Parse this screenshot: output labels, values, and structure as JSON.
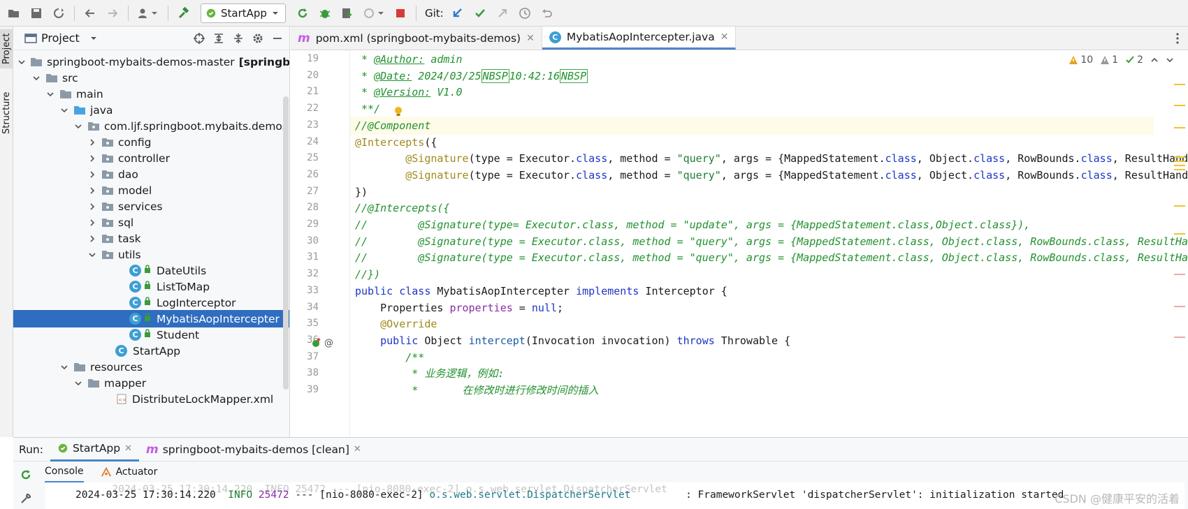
{
  "toolbar": {
    "run_config": "StartApp",
    "git_label": "Git:"
  },
  "left_stripe": {
    "project_tab": "Project",
    "structure_tab": "Structure"
  },
  "project": {
    "title": "Project",
    "tree": [
      {
        "label": "springboot-mybaits-demos-master",
        "bold_suffix": "[springboot",
        "indent": 0,
        "arrow": "down",
        "icon": "module-folder"
      },
      {
        "label": "src",
        "indent": 1,
        "arrow": "down",
        "icon": "folder"
      },
      {
        "label": "main",
        "indent": 2,
        "arrow": "down",
        "icon": "folder"
      },
      {
        "label": "java",
        "indent": 3,
        "arrow": "down",
        "icon": "source-folder"
      },
      {
        "label": "com.ljf.springboot.mybaits.demos",
        "indent": 4,
        "arrow": "down",
        "icon": "package"
      },
      {
        "label": "config",
        "indent": 5,
        "arrow": "right",
        "icon": "package"
      },
      {
        "label": "controller",
        "indent": 5,
        "arrow": "right",
        "icon": "package"
      },
      {
        "label": "dao",
        "indent": 5,
        "arrow": "right",
        "icon": "package"
      },
      {
        "label": "model",
        "indent": 5,
        "arrow": "right",
        "icon": "package"
      },
      {
        "label": "services",
        "indent": 5,
        "arrow": "right",
        "icon": "package"
      },
      {
        "label": "sql",
        "indent": 5,
        "arrow": "right",
        "icon": "package"
      },
      {
        "label": "task",
        "indent": 5,
        "arrow": "right",
        "icon": "package"
      },
      {
        "label": "utils",
        "indent": 5,
        "arrow": "down",
        "icon": "package"
      },
      {
        "label": "DateUtils",
        "indent": 7,
        "arrow": "none",
        "icon": "class"
      },
      {
        "label": "ListToMap",
        "indent": 7,
        "arrow": "none",
        "icon": "class"
      },
      {
        "label": "LogInterceptor",
        "indent": 7,
        "arrow": "none",
        "icon": "class"
      },
      {
        "label": "MybatisAopIntercepter",
        "indent": 7,
        "arrow": "none",
        "icon": "class",
        "selected": true
      },
      {
        "label": "Student",
        "indent": 7,
        "arrow": "none",
        "icon": "class"
      },
      {
        "label": "StartApp",
        "indent": 6,
        "arrow": "none",
        "icon": "boot-class"
      },
      {
        "label": "resources",
        "indent": 3,
        "arrow": "down",
        "icon": "folder"
      },
      {
        "label": "mapper",
        "indent": 4,
        "arrow": "down",
        "icon": "folder"
      },
      {
        "label": "DistributeLockMapper.xml",
        "indent": 6,
        "arrow": "none",
        "icon": "xml-file"
      }
    ]
  },
  "editor_tabs": [
    {
      "label": "pom.xml (springboot-mybaits-demos)",
      "icon": "maven-icon",
      "active": false
    },
    {
      "label": "MybatisAopIntercepter.java",
      "icon": "class-icon",
      "active": true
    }
  ],
  "editor_info": {
    "warnings": "10",
    "weak_warnings": "1",
    "typos": "2"
  },
  "code": {
    "lines": [
      {
        "n": "19",
        "parts": [
          {
            "t": " * ",
            "c": "doc"
          },
          {
            "t": "@Author:",
            "c": "tag"
          },
          {
            "t": " admin",
            "c": "doc"
          }
        ]
      },
      {
        "n": "20",
        "parts": [
          {
            "t": " * ",
            "c": "doc"
          },
          {
            "t": "@Date:",
            "c": "tag"
          },
          {
            "t": " 2024/03/25",
            "c": "doc"
          },
          {
            "t": "NBSP",
            "c": "box"
          },
          {
            "t": "10:42:16",
            "c": "doc"
          },
          {
            "t": "NBSP",
            "c": "box"
          }
        ]
      },
      {
        "n": "21",
        "parts": [
          {
            "t": " * ",
            "c": "doc"
          },
          {
            "t": "@Version:",
            "c": "tag"
          },
          {
            "t": " V1.0",
            "c": "doc"
          }
        ]
      },
      {
        "n": "22",
        "parts": [
          {
            "t": " **/",
            "c": "doc"
          }
        ]
      },
      {
        "n": "23",
        "hl": true,
        "parts": [
          {
            "t": "//@Component",
            "c": "com"
          }
        ]
      },
      {
        "n": "24",
        "parts": [
          {
            "t": "@Intercepts",
            "c": "ann"
          },
          {
            "t": "({",
            "c": ""
          }
        ]
      },
      {
        "n": "25",
        "parts": [
          {
            "t": "        ",
            "c": ""
          },
          {
            "t": "@Signature",
            "c": "ann"
          },
          {
            "t": "(type = Executor.",
            "c": ""
          },
          {
            "t": "class",
            "c": "kw"
          },
          {
            "t": ", method = ",
            "c": ""
          },
          {
            "t": "\"query\"",
            "c": "str"
          },
          {
            "t": ", args = {MappedStatement.",
            "c": ""
          },
          {
            "t": "class",
            "c": "kw"
          },
          {
            "t": ", Object.",
            "c": ""
          },
          {
            "t": "class",
            "c": "kw"
          },
          {
            "t": ", RowBounds.",
            "c": ""
          },
          {
            "t": "class",
            "c": "kw"
          },
          {
            "t": ", ResultHand",
            "c": ""
          }
        ]
      },
      {
        "n": "26",
        "parts": [
          {
            "t": "        ",
            "c": ""
          },
          {
            "t": "@Signature",
            "c": "ann"
          },
          {
            "t": "(type = Executor.",
            "c": ""
          },
          {
            "t": "class",
            "c": "kw"
          },
          {
            "t": ", method = ",
            "c": ""
          },
          {
            "t": "\"query\"",
            "c": "str"
          },
          {
            "t": ", args = {MappedStatement.",
            "c": ""
          },
          {
            "t": "class",
            "c": "kw"
          },
          {
            "t": ", Object.",
            "c": ""
          },
          {
            "t": "class",
            "c": "kw"
          },
          {
            "t": ", RowBounds.",
            "c": ""
          },
          {
            "t": "class",
            "c": "kw"
          },
          {
            "t": ", ResultHand",
            "c": ""
          }
        ]
      },
      {
        "n": "27",
        "parts": [
          {
            "t": "})",
            "c": ""
          }
        ]
      },
      {
        "n": "28",
        "parts": [
          {
            "t": "//@Intercepts({",
            "c": "com"
          }
        ]
      },
      {
        "n": "29",
        "parts": [
          {
            "t": "//        @Signature(type= Executor.class, method = \"update\", args = {MappedStatement.class,Object.class}),",
            "c": "com"
          }
        ]
      },
      {
        "n": "30",
        "parts": [
          {
            "t": "//        @Signature(type = Executor.class, method = \"query\", args = {MappedStatement.class, Object.class, RowBounds.class, ResultHa",
            "c": "com"
          }
        ]
      },
      {
        "n": "31",
        "parts": [
          {
            "t": "//        @Signature(type = Executor.class, method = \"query\", args = {MappedStatement.class, Object.class, RowBounds.class, ResultHa",
            "c": "com"
          }
        ]
      },
      {
        "n": "32",
        "parts": [
          {
            "t": "//})",
            "c": "com"
          }
        ]
      },
      {
        "n": "33",
        "parts": [
          {
            "t": "public class",
            "c": "kw"
          },
          {
            "t": " MybatisAopIntercepter ",
            "c": ""
          },
          {
            "t": "implements",
            "c": "kw"
          },
          {
            "t": " Interceptor {",
            "c": ""
          }
        ]
      },
      {
        "n": "34",
        "parts": [
          {
            "t": "    Properties ",
            "c": ""
          },
          {
            "t": "properties",
            "c": "fld"
          },
          {
            "t": " = ",
            "c": ""
          },
          {
            "t": "null",
            "c": "kw"
          },
          {
            "t": ";",
            "c": ""
          }
        ]
      },
      {
        "n": "35",
        "parts": [
          {
            "t": "    ",
            "c": ""
          },
          {
            "t": "@Override",
            "c": "ann"
          }
        ]
      },
      {
        "n": "36",
        "parts": [
          {
            "t": "    ",
            "c": ""
          },
          {
            "t": "public",
            "c": "kw"
          },
          {
            "t": " Object ",
            "c": ""
          },
          {
            "t": "intercept",
            "c": "fn"
          },
          {
            "t": "(Invocation invocation) ",
            "c": ""
          },
          {
            "t": "throws",
            "c": "kw"
          },
          {
            "t": " Throwable {",
            "c": ""
          }
        ]
      },
      {
        "n": "37",
        "parts": [
          {
            "t": "        ",
            "c": ""
          },
          {
            "t": "/**",
            "c": "doc"
          }
        ]
      },
      {
        "n": "38",
        "parts": [
          {
            "t": "         * 业务逻辑，例如:",
            "c": "doc"
          }
        ]
      },
      {
        "n": "39",
        "parts": [
          {
            "t": "         *       在修改时进行修改时间的插入",
            "c": "doc"
          }
        ]
      }
    ]
  },
  "run": {
    "label": "Run:",
    "tabs": [
      {
        "label": "StartApp",
        "active": true
      },
      {
        "label": "springboot-mybaits-demos [clean]",
        "active": false
      }
    ],
    "console_tabs": [
      {
        "label": "Console",
        "active": true
      },
      {
        "label": "Actuator",
        "active": false
      }
    ],
    "log_line": {
      "ts": "2024-03-25 17:30:14.220",
      "level": "INFO",
      "pid": "25472",
      "sep": "---",
      "thread": "[nio-8080-exec-2]",
      "logger": "o.s.web.servlet.DispatcherServlet",
      "msg": ": FrameworkServlet 'dispatcherServlet': initialization started"
    }
  },
  "watermark": "CSDN @健康平安的活着",
  "colors": {
    "selection": "#2f6dc0",
    "accent": "#4a86c8",
    "keyword": "#1d36c4",
    "comment": "#22912e"
  }
}
